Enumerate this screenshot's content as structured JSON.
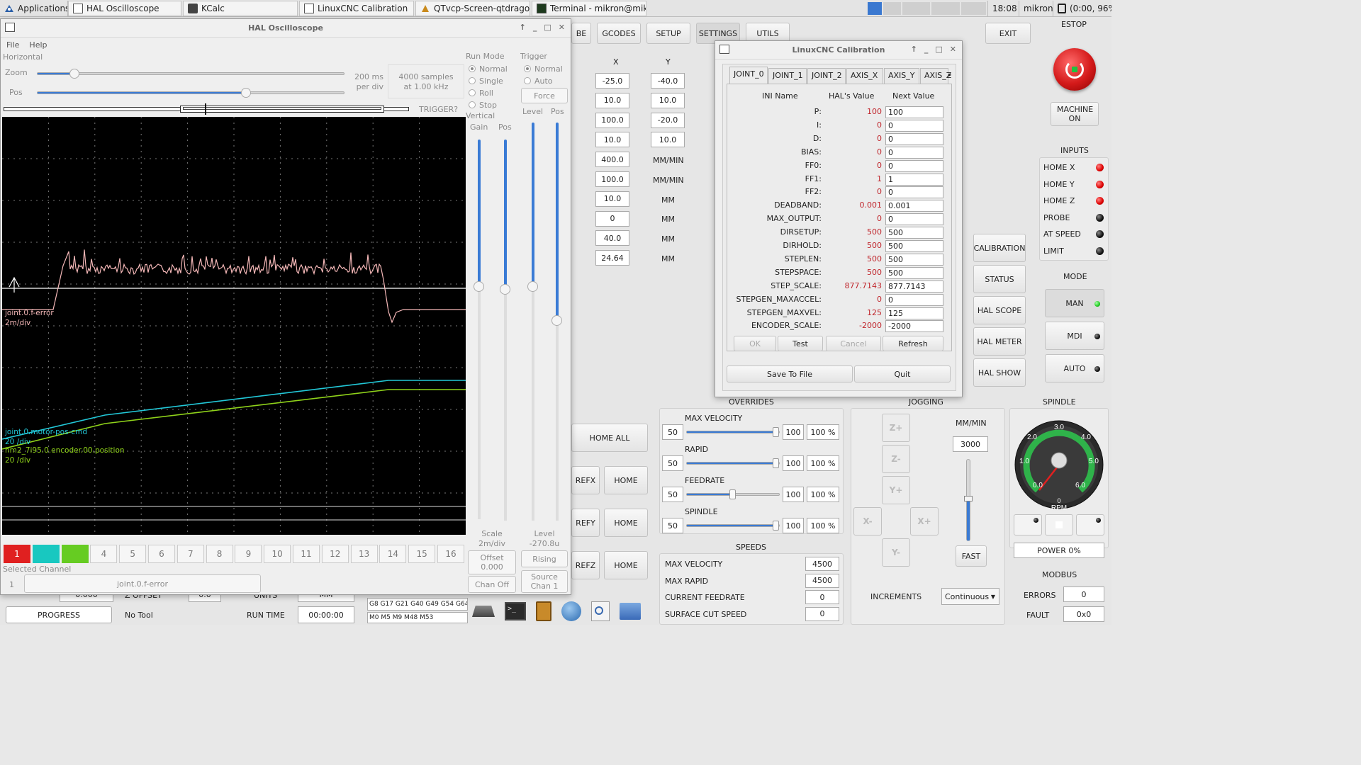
{
  "taskbar": {
    "apps_label": "Applications",
    "windows": [
      "HAL Oscilloscope",
      "KCalc",
      "LinuxCNC Calibration",
      "QTvcp-Screen-qtdragon...",
      "Terminal - mikron@mik..."
    ],
    "clock": "18:08",
    "user": "mikron",
    "battery": "(0:00, 96%)"
  },
  "scope": {
    "title": "HAL Oscilloscope",
    "menu": [
      "File",
      "Help"
    ],
    "horizontal_label": "Horizontal",
    "zoom_label": "Zoom",
    "pos_label": "Pos",
    "zoom_value": 0.12,
    "pos_value": 0.68,
    "rate_line1": "200 ms",
    "rate_line2": "per div",
    "samples_line1": "4000 samples",
    "samples_line2": "at 1.00 kHz",
    "trigger_status": "TRIGGER?",
    "run_mode_label": "Run Mode",
    "run_modes": [
      "Normal",
      "Single",
      "Roll",
      "Stop"
    ],
    "run_mode_selected": "Normal",
    "trigger_label": "Trigger",
    "trigger_modes": [
      "Normal",
      "Auto"
    ],
    "trigger_selected": "Normal",
    "force_label": "Force",
    "vertical_label": "Vertical",
    "gain_label": "Gain",
    "pos_v_label": "Pos",
    "level_label": "Level",
    "level_pos_label": "Pos",
    "traces": [
      {
        "name": "joint.0.f-error",
        "scale": "2m/div",
        "color": "#f5b8b8"
      },
      {
        "name": "joint.0.motor-pos-cmd",
        "scale": "20 /div",
        "color": "#22c8d8"
      },
      {
        "name": "hm2_7i95.0.encoder.00.position",
        "scale": "20 /div",
        "color": "#8fd21a"
      }
    ],
    "channels": [
      "1",
      "2",
      "3",
      "4",
      "5",
      "6",
      "7",
      "8",
      "9",
      "10",
      "11",
      "12",
      "13",
      "14",
      "15",
      "16"
    ],
    "channel_colors": [
      "#e02020",
      "#18c8c0",
      "#66cc22"
    ],
    "selected_channel_label": "Selected Channel",
    "selected_channel_num": "1",
    "selected_channel_name": "joint.0.f-error",
    "scale_label": "Scale",
    "scale_value": "2m/div",
    "offset_label": "Offset",
    "offset_value": "0.000",
    "chan_off_label": "Chan Off",
    "level_title": "Level",
    "level_value": "-270.8u",
    "rising_label": "Rising",
    "source_label": "Source",
    "source_value": "Chan  1"
  },
  "qtdragon": {
    "tabs": [
      "BE",
      "GCODES",
      "SETUP",
      "SETTINGS",
      "UTILS"
    ],
    "exit_label": "EXIT",
    "estop_label": "ESTOP",
    "machine_on_label": "MACHINE ON",
    "col_x": "X",
    "col_y": "Y",
    "x_values": [
      "-25.0",
      "10.0",
      "100.0",
      "10.0",
      "400.0",
      "100.0",
      "10.0",
      "0",
      "40.0",
      "24.64"
    ],
    "y_values": [
      "-40.0",
      "10.0",
      "-20.0",
      "10.0"
    ],
    "y_units": [
      "MM/MIN",
      "MM/MIN",
      "MM",
      "MM",
      "MM",
      "MM"
    ],
    "side_buttons": [
      "CALIBRATION",
      "STATUS",
      "HAL SCOPE",
      "HAL METER",
      "HAL SHOW"
    ],
    "inputs_label": "INPUTS",
    "inputs": [
      {
        "label": "HOME X",
        "state": "red"
      },
      {
        "label": "HOME Y",
        "state": "red"
      },
      {
        "label": "HOME Z",
        "state": "red"
      },
      {
        "label": "PROBE",
        "state": "black"
      },
      {
        "label": "AT SPEED",
        "state": "black"
      },
      {
        "label": "LIMIT",
        "state": "black"
      }
    ],
    "mode_label": "MODE",
    "modes": [
      {
        "label": "MAN",
        "state": "green"
      },
      {
        "label": "MDI",
        "state": "black"
      },
      {
        "label": "AUTO",
        "state": "black"
      }
    ],
    "overrides_label": "OVERRIDES",
    "overrides": [
      {
        "label": "MAX VELOCITY",
        "min": "50",
        "max": "100",
        "pct": "100 %",
        "level": 0.97
      },
      {
        "label": "RAPID",
        "min": "50",
        "max": "100",
        "pct": "100 %",
        "level": 0.97
      },
      {
        "label": "FEEDRATE",
        "min": "50",
        "max": "100",
        "pct": "100 %",
        "level": 0.5
      },
      {
        "label": "SPINDLE",
        "min": "50",
        "max": "100",
        "pct": "100 %",
        "level": 0.97
      }
    ],
    "home_all_label": "HOME ALL",
    "ref_labels": [
      "REFX",
      "REFY",
      "REFZ"
    ],
    "home_label": "HOME",
    "jogging_label": "JOGGING",
    "jog_units": "MM/MIN",
    "jog_rate": "3000",
    "fast_label": "FAST",
    "jog_buttons": [
      "Z+",
      "Z-",
      "Y+",
      "X-",
      "X+",
      "Y-"
    ],
    "increments_label": "INCREMENTS",
    "increments_value": "Continuous",
    "spindle_label": "SPINDLE",
    "rpm_label": "RPM",
    "gauge_ticks": [
      "0.0",
      "1.0",
      "2.0",
      "3.0",
      "4.0",
      "5.0",
      "6.0"
    ],
    "gauge_zero": "0",
    "power_label": "POWER 0%",
    "speeds_label": "SPEEDS",
    "speeds": [
      {
        "label": "MAX VELOCITY",
        "value": "4500"
      },
      {
        "label": "MAX RAPID",
        "value": "4500"
      },
      {
        "label": "CURRENT FEEDRATE",
        "value": "0"
      },
      {
        "label": "SURFACE CUT SPEED",
        "value": "0"
      }
    ],
    "modbus_label": "MODBUS",
    "errors_label": "ERRORS",
    "errors_value": "0",
    "fault_label": "FAULT",
    "fault_value": "0x0",
    "gcodes_line": "G8 G17 G21 G40 G49 G54 G64",
    "mcodes_line": "M0 M5 M9 M48 M53",
    "progress_label": "PROGRESS",
    "tool_label": "No Tool",
    "run_time_label": "RUN TIME",
    "run_time_value": "00:00:00",
    "partial_values": [
      "0.000",
      "Z OFFSET",
      "0.0",
      "UNITS",
      "MM"
    ]
  },
  "calib": {
    "title": "LinuxCNC Calibration",
    "tabs": [
      "JOINT_0",
      "JOINT_1",
      "JOINT_2",
      "AXIS_X",
      "AXIS_Y",
      "AXIS_Z"
    ],
    "hdr_name": "INI Name",
    "hdr_hal": "HAL's Value",
    "hdr_next": "Next Value",
    "rows": [
      {
        "name": "P:",
        "hal": "100",
        "next": "100"
      },
      {
        "name": "I:",
        "hal": "0",
        "next": "0"
      },
      {
        "name": "D:",
        "hal": "0",
        "next": "0"
      },
      {
        "name": "BIAS:",
        "hal": "0",
        "next": "0"
      },
      {
        "name": "FF0:",
        "hal": "0",
        "next": "0"
      },
      {
        "name": "FF1:",
        "hal": "1",
        "next": "1"
      },
      {
        "name": "FF2:",
        "hal": "0",
        "next": "0"
      },
      {
        "name": "DEADBAND:",
        "hal": "0.001",
        "next": "0.001"
      },
      {
        "name": "MAX_OUTPUT:",
        "hal": "0",
        "next": "0"
      },
      {
        "name": "DIRSETUP:",
        "hal": "500",
        "next": "500"
      },
      {
        "name": "DIRHOLD:",
        "hal": "500",
        "next": "500"
      },
      {
        "name": "STEPLEN:",
        "hal": "500",
        "next": "500"
      },
      {
        "name": "STEPSPACE:",
        "hal": "500",
        "next": "500"
      },
      {
        "name": "STEP_SCALE:",
        "hal": "877.7143",
        "next": "877.7143"
      },
      {
        "name": "STEPGEN_MAXACCEL:",
        "hal": "0",
        "next": "0"
      },
      {
        "name": "STEPGEN_MAXVEL:",
        "hal": "125",
        "next": "125"
      },
      {
        "name": "ENCODER_SCALE:",
        "hal": "-2000",
        "next": "-2000"
      }
    ],
    "ok": "OK",
    "test": "Test",
    "cancel": "Cancel",
    "refresh": "Refresh",
    "save": "Save To File",
    "quit": "Quit"
  }
}
